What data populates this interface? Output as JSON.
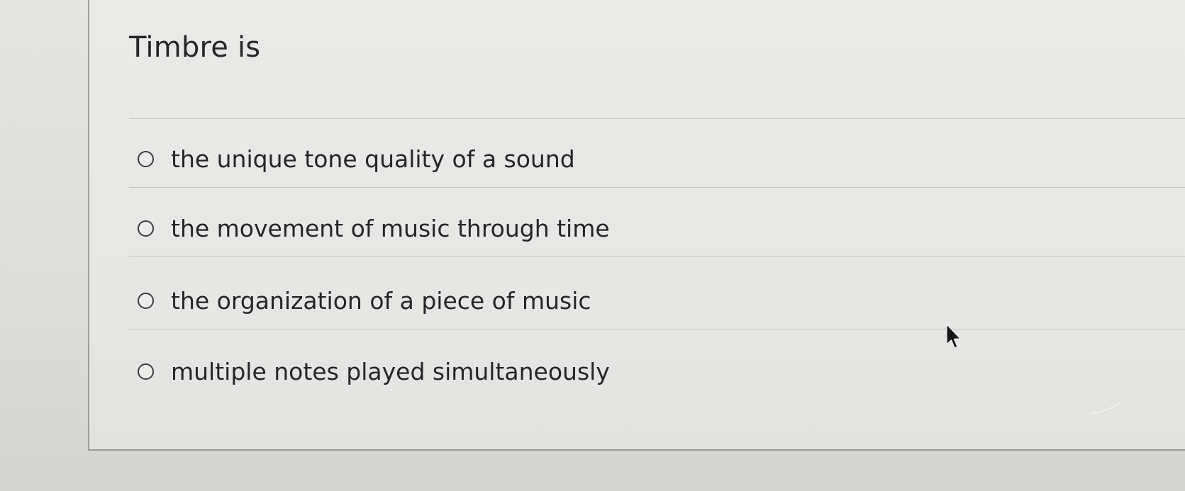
{
  "question": {
    "text": "Timbre is"
  },
  "options": [
    {
      "label": "the unique tone quality of a sound",
      "selected": false
    },
    {
      "label": "the movement of music through time",
      "selected": false
    },
    {
      "label": "the organization of a piece of music",
      "selected": false
    },
    {
      "label": "multiple notes played simultaneously",
      "selected": false
    }
  ],
  "icons": {
    "cursor": "mouse-pointer-icon",
    "radio": "radio-unchecked-icon"
  }
}
